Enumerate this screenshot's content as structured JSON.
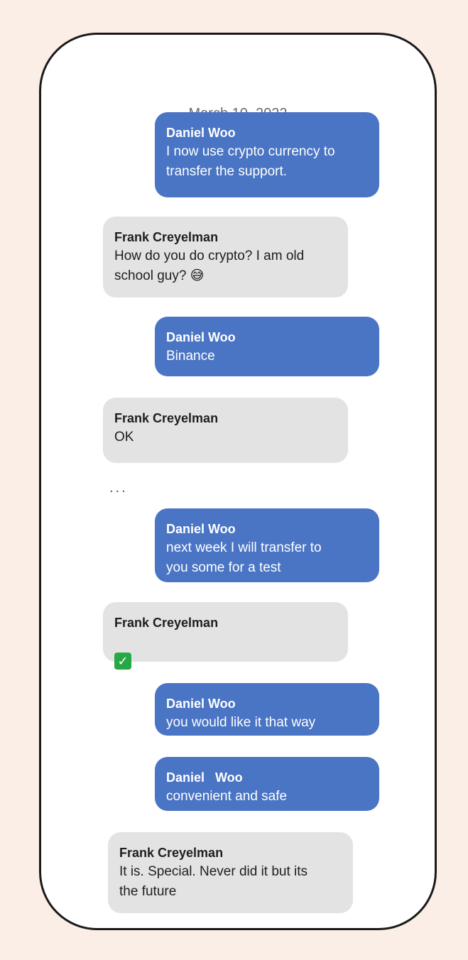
{
  "date": "March 10, 2022",
  "ellipsis": "...",
  "messages": [
    {
      "sender": "Daniel Woo",
      "text": "I now use crypto currency to\ntransfer the support.",
      "direction": "outgoing"
    },
    {
      "sender": "Frank Creyelman",
      "text": "How do you do crypto? I am old\nschool guy? 😅",
      "direction": "incoming"
    },
    {
      "sender": "Daniel Woo",
      "text": "Binance",
      "direction": "outgoing"
    },
    {
      "sender": "Frank Creyelman",
      "text": "OK",
      "direction": "incoming"
    },
    {
      "sender": "Daniel Woo",
      "text": "next week I will transfer to\nyou some for a test",
      "direction": "outgoing"
    },
    {
      "sender": "Frank Creyelman",
      "text": "",
      "icon": "check-mark-icon",
      "direction": "incoming"
    },
    {
      "sender": "Daniel Woo",
      "text": "you would like it that way",
      "direction": "outgoing"
    },
    {
      "sender": "Daniel   Woo",
      "text": "convenient and safe",
      "direction": "outgoing"
    },
    {
      "sender": "Frank Creyelman",
      "text": "It is. Special. Never did it but its\nthe future",
      "direction": "incoming"
    }
  ],
  "colors": {
    "outgoing_bubble": "#4a74c4",
    "incoming_bubble": "#e3e3e3",
    "background": "#fbeee6"
  }
}
